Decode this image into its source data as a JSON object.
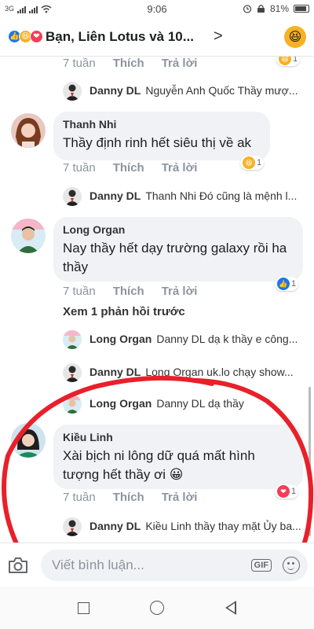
{
  "status_bar": {
    "network": "3G",
    "time": "9:06",
    "battery": "81%"
  },
  "header": {
    "title": "Bạn, Liên Lotus và 10...",
    "chevron": ">",
    "reactions": [
      "like-icon",
      "haha-icon",
      "love-icon"
    ]
  },
  "actions": {
    "like": "Thích",
    "reply": "Trả lời"
  },
  "comments": [
    {
      "time": "7 tuần",
      "badge": {
        "icon": "haha-icon",
        "count": "1"
      },
      "reply": {
        "name": "Danny DL",
        "text": "Nguyễn Anh Quốc Thầy mượ..."
      }
    },
    {
      "name": "Thanh Nhi",
      "text": "Thầy định rinh hết siêu thị về ak",
      "time": "7 tuần",
      "badge": {
        "icon": "haha-icon",
        "count": "1"
      },
      "reply": {
        "name": "Danny DL",
        "text": "Thanh Nhi Đó cũng là mệnh l..."
      }
    },
    {
      "name": "Long Organ",
      "text": "Nay thầy hết dạy trường galaxy rồi ha thầy",
      "time": "7 tuần",
      "badge": {
        "icon": "like-icon",
        "count": "1"
      },
      "more_replies": "Xem 1 phản hồi trước",
      "replies": [
        {
          "name": "Long Organ",
          "text": "Danny DL dạ k thầy e công..."
        },
        {
          "name": "Danny DL",
          "text": "Long Organ uk.lo chạy show..."
        },
        {
          "name": "Long Organ",
          "text": "Danny DL dạ thầy"
        }
      ]
    },
    {
      "name": "Kiều Linh",
      "text": "Xài bịch ni lông dữ quá mất hình tượng hết thầy ơi 😀",
      "time": "7 tuần",
      "badge": {
        "icon": "love-icon",
        "count": "1"
      },
      "reply": {
        "name": "Danny DL",
        "text": "Kiều Linh thầy thay mặt Ủy ba..."
      }
    }
  ],
  "composer": {
    "placeholder": "Viết bình luận...",
    "gif_label": "GIF"
  },
  "colors": {
    "facebook_blue": "#1877f2",
    "haha_yellow": "#f7b125",
    "love_red": "#f33e58",
    "annotation_red": "#e8202a",
    "bubble_gray": "#f0f2f5"
  }
}
